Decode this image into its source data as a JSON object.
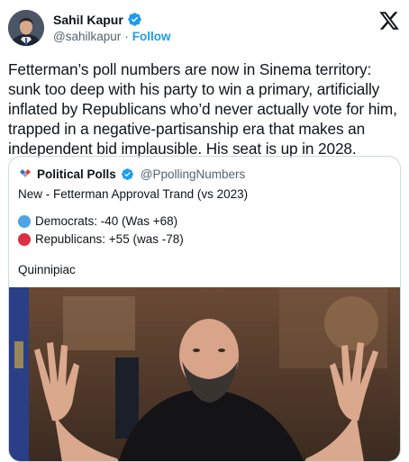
{
  "author": {
    "display_name": "Sahil Kapur",
    "handle": "@sahilkapur",
    "separator": "·",
    "follow_label": "Follow",
    "verified_icon": "verified-badge-icon"
  },
  "tweet": {
    "text": "Fetterman’s poll numbers are now in Sinema territory: sunk too deep with his party to win a primary, artificially inflated by Republicans who’d never actually vote for him, trapped in a negative-partisanship era that makes an independent bid implausible. His seat is up in 2028."
  },
  "quote": {
    "display_name": "Political Polls",
    "handle": "@PpollingNumbers",
    "title": "New - Fetterman Approval Trand (vs 2023)",
    "lines": [
      {
        "label": "Democrats: -40 (Was +68)",
        "color": "#4fa3e3"
      },
      {
        "label": "Republicans: +55 (was -78)",
        "color": "#dd2e44"
      }
    ],
    "source": "Quinnipiac"
  },
  "colors": {
    "accent": "#1d9bf0",
    "text": "#0f1419",
    "muted": "#536471",
    "border": "#cfd9de"
  }
}
